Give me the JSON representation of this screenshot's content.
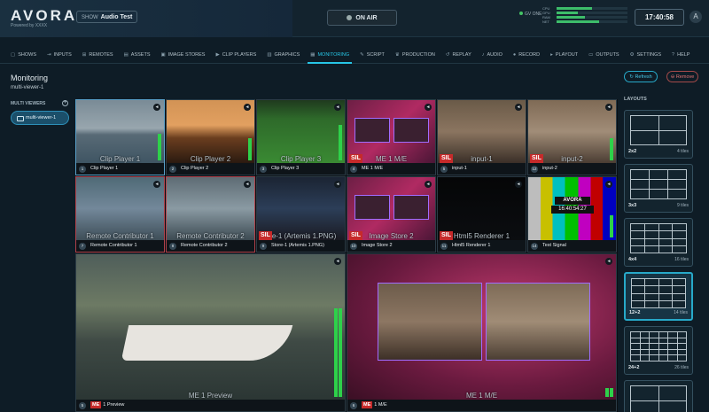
{
  "app": {
    "logo": "AVORA",
    "logo_sub": "Powered by XXXX",
    "show_prefix": "SHOW",
    "show_name": "Audio Test",
    "onair_label": "ON AIR",
    "status_text": "GV ONE",
    "clock": "17:40:58",
    "user_initial": "A"
  },
  "meters": [
    {
      "label": "CPU",
      "value": 0.5
    },
    {
      "label": "GPU",
      "value": 0.3
    },
    {
      "label": "RAM",
      "value": 0.4
    },
    {
      "label": "NET",
      "value": 0.6
    }
  ],
  "nav": [
    {
      "icon": "▢",
      "label": "SHOWS"
    },
    {
      "icon": "⇥",
      "label": "INPUTS"
    },
    {
      "icon": "⊞",
      "label": "REMOTES"
    },
    {
      "icon": "▤",
      "label": "ASSETS"
    },
    {
      "icon": "▣",
      "label": "IMAGE STORES"
    },
    {
      "icon": "▶",
      "label": "CLIP PLAYERS"
    },
    {
      "icon": "▥",
      "label": "GRAPHICS"
    },
    {
      "icon": "▦",
      "label": "MONITORING"
    },
    {
      "icon": "✎",
      "label": "SCRIPT"
    },
    {
      "icon": "♛",
      "label": "PRODUCTION"
    },
    {
      "icon": "↺",
      "label": "REPLAY"
    },
    {
      "icon": "♪",
      "label": "AUDIO"
    },
    {
      "icon": "●",
      "label": "RECORD"
    },
    {
      "icon": "▸",
      "label": "PLAYOUT"
    },
    {
      "icon": "▭",
      "label": "OUTPUTS"
    },
    {
      "icon": "⚙",
      "label": "SETTINGS"
    },
    {
      "icon": "?",
      "label": "HELP"
    }
  ],
  "page": {
    "title": "Monitoring",
    "subtitle": "multi-viewer-1",
    "multiviewers_header": "MULTI VIEWERS",
    "multiviewer_item": "multi-viewer-1",
    "refresh_label": "Refresh",
    "remove_label": "Remove"
  },
  "tiles": [
    {
      "num": "1",
      "caption": "Clip Player 1",
      "bigname": "Clip Player 1",
      "sil": false
    },
    {
      "num": "2",
      "caption": "Clip Player 2",
      "bigname": "Clip Player 2",
      "sil": false
    },
    {
      "num": "3",
      "caption": "Clip Player 3",
      "bigname": "Clip Player 3",
      "sil": false
    },
    {
      "num": "4",
      "caption": "ME 1 M/E",
      "bigname": "ME 1 M/E",
      "sil": true
    },
    {
      "num": "5",
      "caption": "input-1",
      "bigname": "input-1",
      "sil": true
    },
    {
      "num": "12",
      "caption": "input-2",
      "bigname": "input-2",
      "sil": true
    },
    {
      "num": "7",
      "caption": "Remote Contributor 1",
      "bigname": "Remote Contributor 1",
      "sil": false
    },
    {
      "num": "8",
      "caption": "Remote Contributor 2",
      "bigname": "Remote Contributor 2",
      "sil": false
    },
    {
      "num": "9",
      "caption": "Store-1 (Artemis 1.PNG)",
      "bigname": "ore-1 (Artemis 1.PNG)",
      "sil": true
    },
    {
      "num": "10",
      "caption": "Image Store 2",
      "bigname": "Image Store 2",
      "sil": true
    },
    {
      "num": "11",
      "caption": "Html5 Renderer 1",
      "bigname": "Html5 Renderer 1",
      "sil": true
    },
    {
      "num": "14",
      "caption": "Test Signal",
      "bigname": "",
      "sil": false
    }
  ],
  "big_tiles": [
    {
      "num": "5",
      "badge": "ME",
      "caption": "1 Preview",
      "bigname": "ME 1 Preview"
    },
    {
      "num": "6",
      "badge": "ME",
      "caption": "1 M/E",
      "bigname": "ME 1 M/E"
    }
  ],
  "test_signal": {
    "brand": "AVORA",
    "timecode": "16:40:54:27"
  },
  "layouts": {
    "header": "LAYOUTS",
    "items": [
      {
        "name": "2x2",
        "tiles": "4 tiles",
        "selected": false
      },
      {
        "name": "3x3",
        "tiles": "9 tiles",
        "selected": false
      },
      {
        "name": "4x4",
        "tiles": "16 tiles",
        "selected": false
      },
      {
        "name": "12+2",
        "tiles": "14 tiles",
        "selected": true
      },
      {
        "name": "24+2",
        "tiles": "26 tiles",
        "selected": false
      },
      {
        "name": "",
        "tiles": "",
        "selected": false
      }
    ]
  }
}
